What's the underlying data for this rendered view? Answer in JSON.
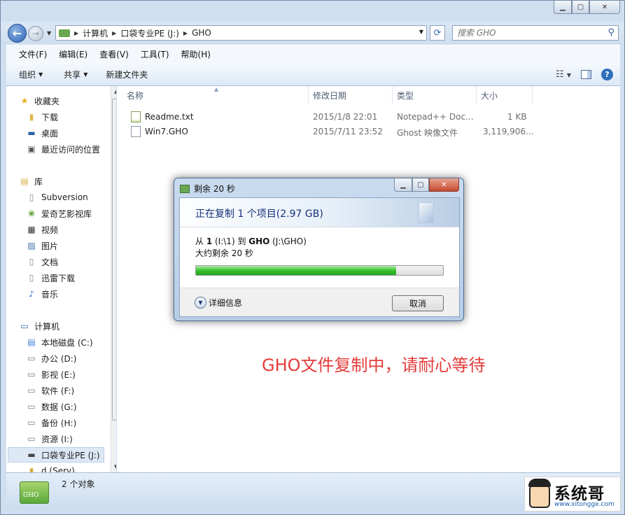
{
  "address": {
    "crumbs": [
      "计算机",
      "口袋专业PE (J:)",
      "GHO"
    ],
    "search_placeholder": "搜索 GHO"
  },
  "menu": [
    "文件(F)",
    "编辑(E)",
    "查看(V)",
    "工具(T)",
    "帮助(H)"
  ],
  "toolbar": {
    "organize": "组织",
    "share": "共享",
    "new_folder": "新建文件夹"
  },
  "nav": {
    "favorites": "收藏夹",
    "fav_items": [
      "下载",
      "桌面",
      "最近访问的位置"
    ],
    "libraries": "库",
    "lib_items": [
      "Subversion",
      "爱奇艺影视库",
      "视频",
      "图片",
      "文档",
      "迅雷下载",
      "音乐"
    ],
    "computer": "计算机",
    "drives": [
      "本地磁盘 (C:)",
      "办公 (D:)",
      "影视 (E:)",
      "软件 (F:)",
      "数据 (G:)",
      "备份 (H:)",
      "资源 (I:)",
      "口袋专业PE (J:)",
      "d (Serv)"
    ]
  },
  "columns": {
    "name": "名称",
    "date": "修改日期",
    "type": "类型",
    "size": "大小"
  },
  "files": [
    {
      "name": "Readme.txt",
      "date": "2015/1/8 22:01",
      "type": "Notepad++ Doc...",
      "size": "1 KB"
    },
    {
      "name": "Win7.GHO",
      "date": "2015/7/11 23:52",
      "type": "Ghost 映像文件",
      "size": "3,119,906..."
    }
  ],
  "dialog": {
    "title": "剩余 20 秒",
    "heading": "正在复制 1 个项目(2.97 GB)",
    "line1": {
      "a": "从 ",
      "b": "1",
      "c": " (I:\\1) 到 ",
      "d": "GHO",
      "e": " (J:\\GHO)"
    },
    "line2": "大约剩余 20 秒",
    "progress": 0.81,
    "details": "详细信息",
    "cancel": "取消"
  },
  "message": "GHO文件复制中，请耐心等待",
  "status": {
    "count": "2 个对象",
    "folder_label": "GHO"
  },
  "watermark": {
    "title": "系统哥",
    "url": "www.xitongge.com"
  },
  "colors": {
    "message": "#e43b3b",
    "progress": "#37c22d"
  }
}
